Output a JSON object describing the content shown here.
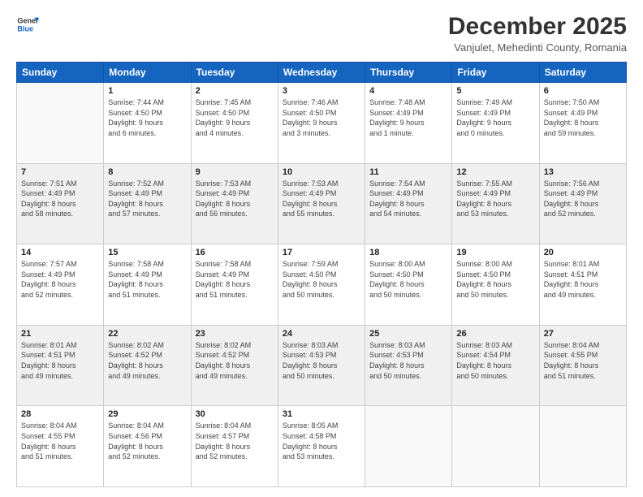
{
  "header": {
    "logo_line1": "General",
    "logo_line2": "Blue",
    "month": "December 2025",
    "location": "Vanjulet, Mehedinti County, Romania"
  },
  "weekdays": [
    "Sunday",
    "Monday",
    "Tuesday",
    "Wednesday",
    "Thursday",
    "Friday",
    "Saturday"
  ],
  "weeks": [
    [
      {
        "day": "",
        "info": ""
      },
      {
        "day": "1",
        "info": "Sunrise: 7:44 AM\nSunset: 4:50 PM\nDaylight: 9 hours\nand 6 minutes."
      },
      {
        "day": "2",
        "info": "Sunrise: 7:45 AM\nSunset: 4:50 PM\nDaylight: 9 hours\nand 4 minutes."
      },
      {
        "day": "3",
        "info": "Sunrise: 7:46 AM\nSunset: 4:50 PM\nDaylight: 9 hours\nand 3 minutes."
      },
      {
        "day": "4",
        "info": "Sunrise: 7:48 AM\nSunset: 4:49 PM\nDaylight: 9 hours\nand 1 minute."
      },
      {
        "day": "5",
        "info": "Sunrise: 7:49 AM\nSunset: 4:49 PM\nDaylight: 9 hours\nand 0 minutes."
      },
      {
        "day": "6",
        "info": "Sunrise: 7:50 AM\nSunset: 4:49 PM\nDaylight: 8 hours\nand 59 minutes."
      }
    ],
    [
      {
        "day": "7",
        "info": "Sunrise: 7:51 AM\nSunset: 4:49 PM\nDaylight: 8 hours\nand 58 minutes."
      },
      {
        "day": "8",
        "info": "Sunrise: 7:52 AM\nSunset: 4:49 PM\nDaylight: 8 hours\nand 57 minutes."
      },
      {
        "day": "9",
        "info": "Sunrise: 7:53 AM\nSunset: 4:49 PM\nDaylight: 8 hours\nand 56 minutes."
      },
      {
        "day": "10",
        "info": "Sunrise: 7:53 AM\nSunset: 4:49 PM\nDaylight: 8 hours\nand 55 minutes."
      },
      {
        "day": "11",
        "info": "Sunrise: 7:54 AM\nSunset: 4:49 PM\nDaylight: 8 hours\nand 54 minutes."
      },
      {
        "day": "12",
        "info": "Sunrise: 7:55 AM\nSunset: 4:49 PM\nDaylight: 8 hours\nand 53 minutes."
      },
      {
        "day": "13",
        "info": "Sunrise: 7:56 AM\nSunset: 4:49 PM\nDaylight: 8 hours\nand 52 minutes."
      }
    ],
    [
      {
        "day": "14",
        "info": "Sunrise: 7:57 AM\nSunset: 4:49 PM\nDaylight: 8 hours\nand 52 minutes."
      },
      {
        "day": "15",
        "info": "Sunrise: 7:58 AM\nSunset: 4:49 PM\nDaylight: 8 hours\nand 51 minutes."
      },
      {
        "day": "16",
        "info": "Sunrise: 7:58 AM\nSunset: 4:49 PM\nDaylight: 8 hours\nand 51 minutes."
      },
      {
        "day": "17",
        "info": "Sunrise: 7:59 AM\nSunset: 4:50 PM\nDaylight: 8 hours\nand 50 minutes."
      },
      {
        "day": "18",
        "info": "Sunrise: 8:00 AM\nSunset: 4:50 PM\nDaylight: 8 hours\nand 50 minutes."
      },
      {
        "day": "19",
        "info": "Sunrise: 8:00 AM\nSunset: 4:50 PM\nDaylight: 8 hours\nand 50 minutes."
      },
      {
        "day": "20",
        "info": "Sunrise: 8:01 AM\nSunset: 4:51 PM\nDaylight: 8 hours\nand 49 minutes."
      }
    ],
    [
      {
        "day": "21",
        "info": "Sunrise: 8:01 AM\nSunset: 4:51 PM\nDaylight: 8 hours\nand 49 minutes."
      },
      {
        "day": "22",
        "info": "Sunrise: 8:02 AM\nSunset: 4:52 PM\nDaylight: 8 hours\nand 49 minutes."
      },
      {
        "day": "23",
        "info": "Sunrise: 8:02 AM\nSunset: 4:52 PM\nDaylight: 8 hours\nand 49 minutes."
      },
      {
        "day": "24",
        "info": "Sunrise: 8:03 AM\nSunset: 4:53 PM\nDaylight: 8 hours\nand 50 minutes."
      },
      {
        "day": "25",
        "info": "Sunrise: 8:03 AM\nSunset: 4:53 PM\nDaylight: 8 hours\nand 50 minutes."
      },
      {
        "day": "26",
        "info": "Sunrise: 8:03 AM\nSunset: 4:54 PM\nDaylight: 8 hours\nand 50 minutes."
      },
      {
        "day": "27",
        "info": "Sunrise: 8:04 AM\nSunset: 4:55 PM\nDaylight: 8 hours\nand 51 minutes."
      }
    ],
    [
      {
        "day": "28",
        "info": "Sunrise: 8:04 AM\nSunset: 4:55 PM\nDaylight: 8 hours\nand 51 minutes."
      },
      {
        "day": "29",
        "info": "Sunrise: 8:04 AM\nSunset: 4:56 PM\nDaylight: 8 hours\nand 52 minutes."
      },
      {
        "day": "30",
        "info": "Sunrise: 8:04 AM\nSunset: 4:57 PM\nDaylight: 8 hours\nand 52 minutes."
      },
      {
        "day": "31",
        "info": "Sunrise: 8:05 AM\nSunset: 4:58 PM\nDaylight: 8 hours\nand 53 minutes."
      },
      {
        "day": "",
        "info": ""
      },
      {
        "day": "",
        "info": ""
      },
      {
        "day": "",
        "info": ""
      }
    ]
  ]
}
